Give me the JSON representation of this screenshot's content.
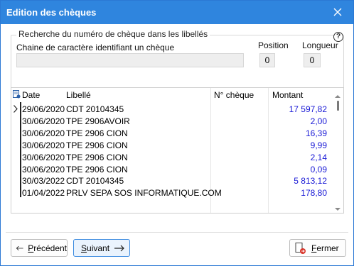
{
  "window": {
    "title": "Edition des chèques",
    "close_icon": "close-icon"
  },
  "search": {
    "legend": "Recherche du numéro de chèque dans les libellés",
    "help_glyph": "?",
    "chaine_label": "Chaine de caractère identifiant un chèque",
    "chaine_value": "",
    "position_label": "Position",
    "position_value": "0",
    "longueur_label": "Longueur",
    "longueur_value": "0"
  },
  "table": {
    "columns": {
      "date": "Date",
      "libelle": "Libellé",
      "cheque": "N° chèque",
      "montant": "Montant"
    },
    "rows": [
      {
        "date": "29/06/2020",
        "libelle": "CDT 20104345",
        "cheque": "",
        "montant": "17 597,82"
      },
      {
        "date": "30/06/2020",
        "libelle": "TPE 2906AVOIR",
        "cheque": "",
        "montant": "2,00"
      },
      {
        "date": "30/06/2020",
        "libelle": "TPE 2906 CION",
        "cheque": "",
        "montant": "16,39"
      },
      {
        "date": "30/06/2020",
        "libelle": "TPE 2906 CION",
        "cheque": "",
        "montant": "9,99"
      },
      {
        "date": "30/06/2020",
        "libelle": "TPE 2906 CION",
        "cheque": "",
        "montant": "2,14"
      },
      {
        "date": "30/06/2020",
        "libelle": "TPE 2906 CION",
        "cheque": "",
        "montant": "0,09"
      },
      {
        "date": "30/03/2022",
        "libelle": "CDT 20104345",
        "cheque": "",
        "montant": "5 813,12"
      },
      {
        "date": "01/04/2022",
        "libelle": "PRLV SEPA SOS INFORMATIQUE.COM",
        "cheque": "",
        "montant": "178,80"
      }
    ]
  },
  "buttons": {
    "prev_first": "P",
    "prev_rest": "récédent",
    "next_first": "S",
    "next_rest": "uivant",
    "close_first": "F",
    "close_rest": "ermer"
  },
  "colors": {
    "titlebar": "#2f85de",
    "amount": "#1a1ad6",
    "accent_button": "#3c8be0"
  }
}
